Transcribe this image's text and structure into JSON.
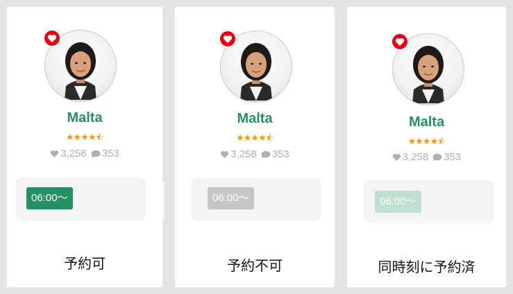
{
  "cards": [
    {
      "name": "Malta",
      "rating": 4.5,
      "stars": "★★★★⯪",
      "likes": "3,258",
      "comments": "353",
      "slot_time": "06:00〜",
      "slot_color": "#239163",
      "caption": "予約可",
      "favorite_icon": "heart-icon"
    },
    {
      "name": "Malta",
      "rating": 4.5,
      "stars": "★★★★⯪",
      "likes": "3,258",
      "comments": "353",
      "slot_time": "06:00〜",
      "slot_color": "#c6c6c6",
      "caption": "予約不可",
      "favorite_icon": "heart-icon"
    },
    {
      "name": "Malta",
      "rating": 4.5,
      "stars": "★★★★⯪",
      "likes": "3,258",
      "comments": "353",
      "slot_time": "06:00〜",
      "slot_color": "#bfe0d1",
      "caption": "同時刻に予約済",
      "favorite_icon": "heart-icon"
    }
  ],
  "colors": {
    "accent_green": "#239163",
    "favorite_red": "#e60012",
    "star_orange": "#f39800",
    "muted_gray": "#b0b0b0"
  }
}
